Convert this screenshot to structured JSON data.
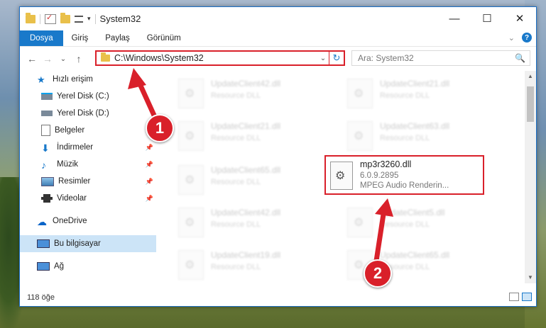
{
  "window": {
    "title": "System32",
    "controls": {
      "minimize": "—",
      "maximize": "☐",
      "close": "✕"
    }
  },
  "ribbon": {
    "tabs": [
      "Dosya",
      "Giriş",
      "Paylaş",
      "Görünüm"
    ],
    "expand": "⌄",
    "help": "?"
  },
  "nav": {
    "back": "←",
    "forward": "→",
    "recent": "⌄",
    "up": "↑",
    "address": "C:\\Windows\\System32",
    "address_dropdown": "⌄",
    "refresh": "↻",
    "search_placeholder": "Ara: System32",
    "search_icon": "🔍"
  },
  "sidebar": {
    "items": [
      {
        "label": "Hızlı erişim",
        "icon": "star-icon",
        "pinned": false
      },
      {
        "label": "Yerel Disk (C:)",
        "icon": "drive-icon",
        "pinned": false
      },
      {
        "label": "Yerel Disk (D:)",
        "icon": "drive-icon",
        "pinned": false
      },
      {
        "label": "Belgeler",
        "icon": "documents-icon",
        "pinned": false
      },
      {
        "label": "İndirmeler",
        "icon": "downloads-icon",
        "pinned": true
      },
      {
        "label": "Müzik",
        "icon": "music-icon",
        "pinned": true
      },
      {
        "label": "Resimler",
        "icon": "pictures-icon",
        "pinned": true
      },
      {
        "label": "Videolar",
        "icon": "videos-icon",
        "pinned": true
      },
      {
        "label": "OneDrive",
        "icon": "onedrive-icon",
        "pinned": false
      },
      {
        "label": "Bu bilgisayar",
        "icon": "computer-icon",
        "pinned": false
      },
      {
        "label": "Ağ",
        "icon": "network-icon",
        "pinned": false
      }
    ],
    "pin_glyph": "📌"
  },
  "files": {
    "background": [
      {
        "name": "UpdateClient42.dll",
        "desc": "Resource DLL"
      },
      {
        "name": "UpdateClient21.dll",
        "desc": "Resource DLL"
      },
      {
        "name": "UpdateClient21.dll",
        "desc": "Resource DLL"
      },
      {
        "name": "UpdateClient63.dll",
        "desc": "Resource DLL"
      },
      {
        "name": "UpdateClient65.dll",
        "desc": "Resource DLL"
      },
      {
        "name": "UpdateClient42.dll",
        "desc": "Resource DLL"
      },
      {
        "name": "UpdateClient5.dll",
        "desc": "Resource DLL"
      },
      {
        "name": "UpdateClient19.dll",
        "desc": "Resource DLL"
      },
      {
        "name": "UpdateClient65.dll",
        "desc": "Resource DLL"
      }
    ],
    "highlighted": {
      "name": "mp3r3260.dll",
      "version": "6.0.9.2895",
      "desc": "MPEG Audio Renderin..."
    }
  },
  "status": {
    "count": "118 öğe"
  },
  "annotations": {
    "badge1": "1",
    "badge2": "2",
    "color": "#d9202a"
  }
}
